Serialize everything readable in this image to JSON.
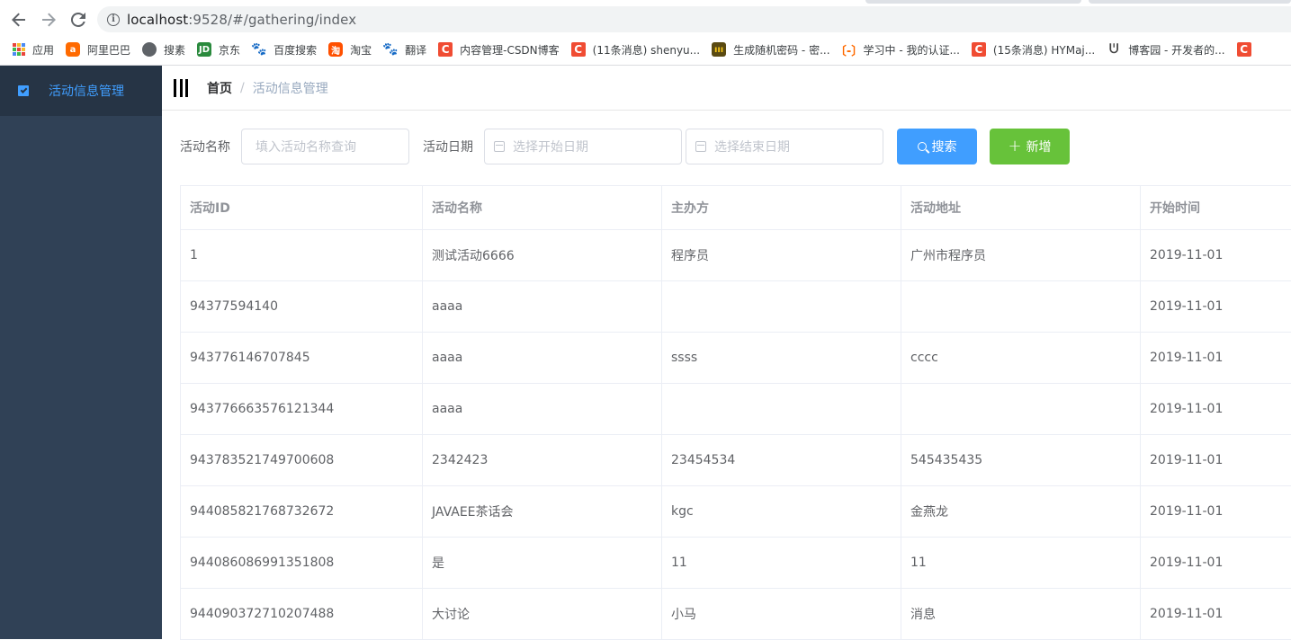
{
  "browser": {
    "url_host": "localhost",
    "url_path": ":9528/#/gathering/index",
    "bookmarks": [
      {
        "label": "应用",
        "icon": "apps-grid-icon"
      },
      {
        "label": "阿里巴巴",
        "icon": "alibaba-icon"
      },
      {
        "label": "搜素",
        "icon": "globe-icon"
      },
      {
        "label": "京东",
        "icon": "jd-icon"
      },
      {
        "label": "百度搜索",
        "icon": "baidu-paw-icon"
      },
      {
        "label": "淘宝",
        "icon": "taobao-icon"
      },
      {
        "label": "翻译",
        "icon": "baidu-paw-icon"
      },
      {
        "label": "内容管理-CSDN博客",
        "icon": "csdn-icon"
      },
      {
        "label": "(11条消息) shenyu...",
        "icon": "csdn-icon"
      },
      {
        "label": "生成随机密码 - 密...",
        "icon": "password-generator-icon"
      },
      {
        "label": "学习中 - 我的认证...",
        "icon": "aliyun-icon"
      },
      {
        "label": "(15条消息) HYMaj...",
        "icon": "csdn-icon"
      },
      {
        "label": "博客园 - 开发者的...",
        "icon": "cnblogs-icon"
      }
    ],
    "bookmark_fav_text": {
      "alibaba": "a",
      "jd": "JD",
      "baidu": "🐾",
      "taobao": "淘",
      "csdn": "C",
      "gen": "ııı",
      "study": "〔-〕",
      "cnblogs": "ᕫ"
    }
  },
  "sidebar": {
    "items": [
      {
        "label": "活动信息管理",
        "icon": "document-icon",
        "active": true
      }
    ]
  },
  "navbar": {
    "breadcrumb_home": "首页",
    "breadcrumb_sep": "/",
    "breadcrumb_current": "活动信息管理"
  },
  "filters": {
    "name_label": "活动名称",
    "name_placeholder": "填入活动名称查询",
    "date_label": "活动日期",
    "start_placeholder": "选择开始日期",
    "end_placeholder": "选择结束日期",
    "search_button": "搜索",
    "add_button": "新增"
  },
  "table": {
    "columns": [
      "活动ID",
      "活动名称",
      "主办方",
      "活动地址",
      "开始时间"
    ],
    "rows": [
      [
        "1",
        "测试活动6666",
        "程序员",
        "广州市程序员",
        "2019-11-01"
      ],
      [
        "94377594140",
        "aaaa",
        "",
        "",
        "2019-11-01"
      ],
      [
        "943776146707845",
        "aaaa",
        "ssss",
        "cccc",
        "2019-11-01"
      ],
      [
        "943776663576121344",
        "aaaa",
        "",
        "",
        "2019-11-01"
      ],
      [
        "943783521749700608",
        "2342423",
        "23454534",
        "545435435",
        "2019-11-01"
      ],
      [
        "944085821768732672",
        "JAVAEE茶话会",
        "kgc",
        "金燕龙",
        "2019-11-01"
      ],
      [
        "944086086991351808",
        "是",
        "11",
        "11",
        "2019-11-01"
      ],
      [
        "944090372710207488",
        "大讨论",
        "小马",
        "消息",
        "2019-11-01"
      ]
    ]
  },
  "colors": {
    "sidebar_bg": "#304156",
    "sidebar_active_bg": "#263445",
    "accent": "#409eff",
    "success": "#67c23a"
  }
}
